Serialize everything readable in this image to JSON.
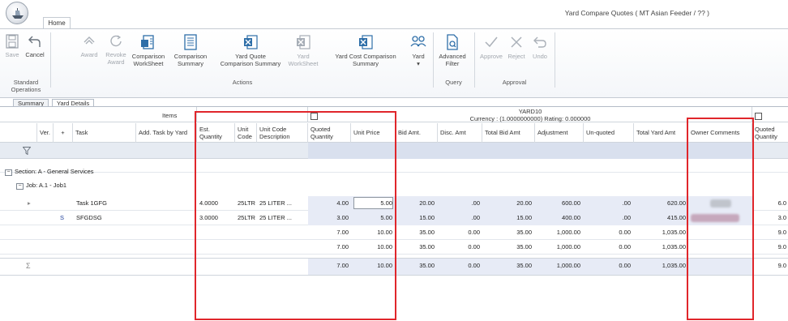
{
  "window": {
    "title": "Yard Compare Quotes ( MT Asian Feeder / ?? )",
    "tab": "Home"
  },
  "ribbon": {
    "save": "Save",
    "cancel": "Cancel",
    "award": "Award",
    "revoke": "Revoke",
    "revoke2": "Award",
    "comparison_ws": "Comparison",
    "comparison_ws2": "WorkSheet",
    "comparison_sum": "Comparison",
    "comparison_sum2": "Summary",
    "yard_quote": "Yard Quote",
    "yard_quote2": "Comparison Summary",
    "yard_ws": "Yard",
    "yard_ws2": "WorkSheet",
    "yard_cost": "Yard Cost Comparison",
    "yard_cost2": "Summary",
    "yard": "Yard",
    "adv": "Advanced",
    "adv2": "Filter",
    "approve": "Approve",
    "reject": "Reject",
    "undo": "Undo",
    "groups": {
      "standard": "Standard Operations",
      "actions": "Actions",
      "query": "Query",
      "approval": "Approval"
    }
  },
  "view_tabs": [
    "Summary",
    "Yard Details"
  ],
  "grid": {
    "items_label": "Items",
    "yard_name": "YARD10",
    "currency_line": "Currency : (1.0000000000)    Rating: 0.000000",
    "headers": {
      "ver": "Ver.",
      "plus": "+",
      "task": "Task",
      "add_task": "Add. Task by Yard",
      "est_qty": "Est. Quantity",
      "unit_code": "Unit Code",
      "unit_desc": "Unit Code Description",
      "quoted_qty": "Quoted Quantity",
      "unit_price": "Unit Price",
      "bid_amt": "Bid Amt.",
      "disc_amt": "Disc. Amt",
      "total_bid": "Total Bid Amt",
      "adjustment": "Adjustment",
      "unquoted": "Un-quoted",
      "total_yard": "Total Yard Amt",
      "owner_comments": "Owner Comments",
      "quoted_qty2": "Quoted Quantity"
    },
    "section": "Section:  A - General Services",
    "job": "Job:  A.1 - Job1",
    "rows": [
      {
        "ver": "",
        "task": "Task 1GFG",
        "est_qty": "4.0000",
        "unit_code": "25LTR",
        "unit_desc": "25 LITER ...",
        "quoted_qty": "4.00",
        "unit_price": "5.00",
        "bid_amt": "20.00",
        "disc_amt": ".00",
        "total_bid": "20.00",
        "adjustment": "600.00",
        "unquoted": ".00",
        "total_yard": "620.00",
        "quoted_qty2": "6.0"
      },
      {
        "ver": "S",
        "task": "SFGDSG",
        "est_qty": "3.0000",
        "unit_code": "25LTR",
        "unit_desc": "25 LITER ...",
        "quoted_qty": "3.00",
        "unit_price": "5.00",
        "bid_amt": "15.00",
        "disc_amt": ".00",
        "total_bid": "15.00",
        "adjustment": "400.00",
        "unquoted": ".00",
        "total_yard": "415.00",
        "quoted_qty2": "3.0"
      }
    ],
    "subtotals": [
      {
        "quoted_qty": "7.00",
        "unit_price": "10.00",
        "bid_amt": "35.00",
        "disc_amt": "0.00",
        "total_bid": "35.00",
        "adjustment": "1,000.00",
        "unquoted": "0.00",
        "total_yard": "1,035.00",
        "quoted_qty2": "9.0"
      },
      {
        "quoted_qty": "7.00",
        "unit_price": "10.00",
        "bid_amt": "35.00",
        "disc_amt": "0.00",
        "total_bid": "35.00",
        "adjustment": "1,000.00",
        "unquoted": "0.00",
        "total_yard": "1,035.00",
        "quoted_qty2": "9.0"
      }
    ],
    "total": {
      "quoted_qty": "7.00",
      "unit_price": "10.00",
      "bid_amt": "35.00",
      "disc_amt": "0.00",
      "total_bid": "35.00",
      "adjustment": "1,000.00",
      "unquoted": "0.00",
      "total_yard": "1,035.00",
      "quoted_qty2": "9.0"
    }
  },
  "colors": {
    "highlight_box": "#e0262b",
    "quoted_band": "#e7ebf6",
    "filter_row": "#e6ebf2"
  }
}
